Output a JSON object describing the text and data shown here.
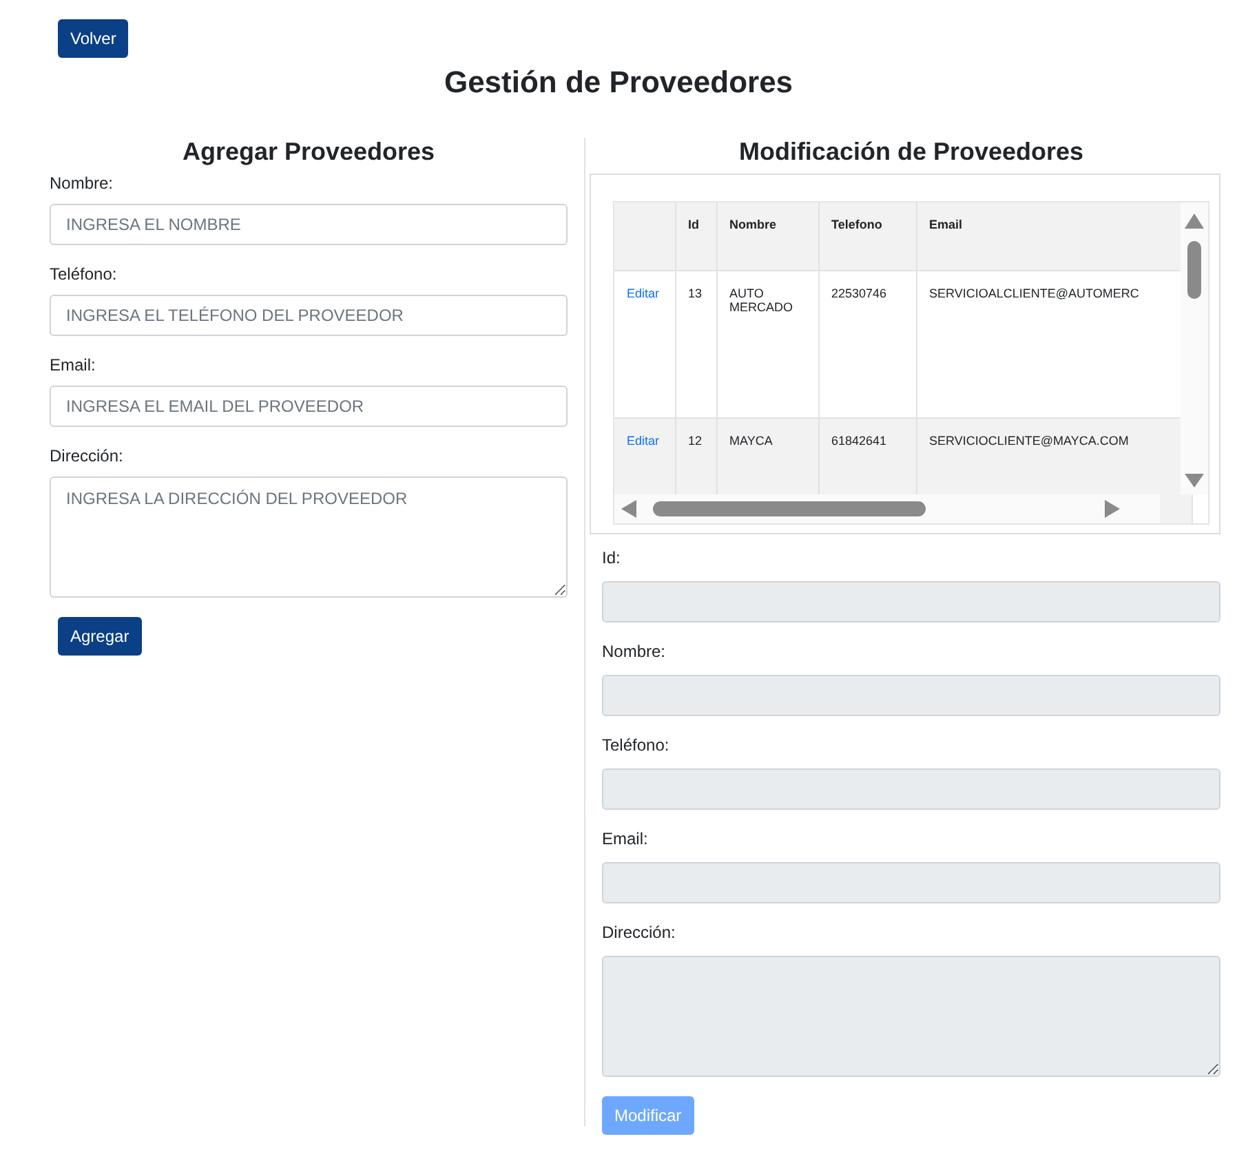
{
  "back_button": "Volver",
  "title": "Gestión de Proveedores",
  "add_form": {
    "title": "Agregar Proveedores",
    "fields": [
      {
        "label": "Nombre:",
        "placeholder": "INGRESA EL NOMBRE",
        "kind": "input"
      },
      {
        "label": "Teléfono:",
        "placeholder": "INGRESA EL TELÉFONO DEL PROVEEDOR",
        "kind": "input"
      },
      {
        "label": "Email:",
        "placeholder": "INGRESA EL EMAIL DEL PROVEEDOR",
        "kind": "input"
      },
      {
        "label": "Dirección:",
        "placeholder": "INGRESA LA DIRECCIÓN DEL PROVEEDOR",
        "kind": "textarea"
      }
    ],
    "button": {
      "label": "Agregar",
      "disabled": false
    }
  },
  "edit_form": {
    "title": "Modificación de Proveedores",
    "table": {
      "columns": [
        "Id",
        "Nombre",
        "Telefono",
        "Email"
      ],
      "rows": [
        {
          "action": "Editar",
          "cells": [
            "13",
            "AUTO MERCADO",
            "22530746",
            "SERVICIOALCLIENTE@AUTOMERC"
          ]
        },
        {
          "action": "Editar",
          "cells": [
            "12",
            "MAYCA",
            "61842641",
            "SERVICIOCLIENTE@MAYCA.COM"
          ]
        }
      ]
    },
    "fields": [
      {
        "label": "Id:",
        "kind": "input",
        "disabled": true
      },
      {
        "label": "Nombre:",
        "kind": "input",
        "disabled": true
      },
      {
        "label": "Teléfono:",
        "kind": "input",
        "disabled": true
      },
      {
        "label": "Email:",
        "kind": "input",
        "disabled": true
      },
      {
        "label": "Dirección:",
        "kind": "textarea",
        "disabled": true
      }
    ],
    "button": {
      "label": "Modificar",
      "disabled": true
    }
  }
}
